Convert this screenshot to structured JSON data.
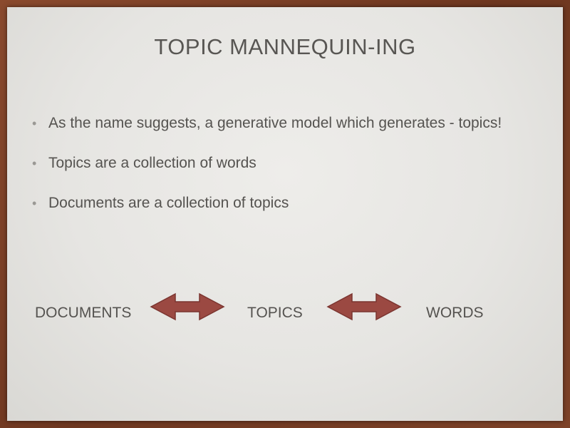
{
  "slide": {
    "title": "TOPIC MANNEQUIN-ING",
    "bullets": [
      "As the name suggests, a generative model which generates - topics!",
      "Topics are a collection of words",
      "Documents are a collection of topics"
    ],
    "flow": {
      "nodes": [
        "DOCUMENTS",
        "TOPICS",
        "WORDS"
      ],
      "arrow_color": "#9b4942",
      "arrow_stroke": "#7b3530"
    }
  },
  "icons": {
    "bullet": "•",
    "connector": "double-headed-arrow-icon"
  }
}
